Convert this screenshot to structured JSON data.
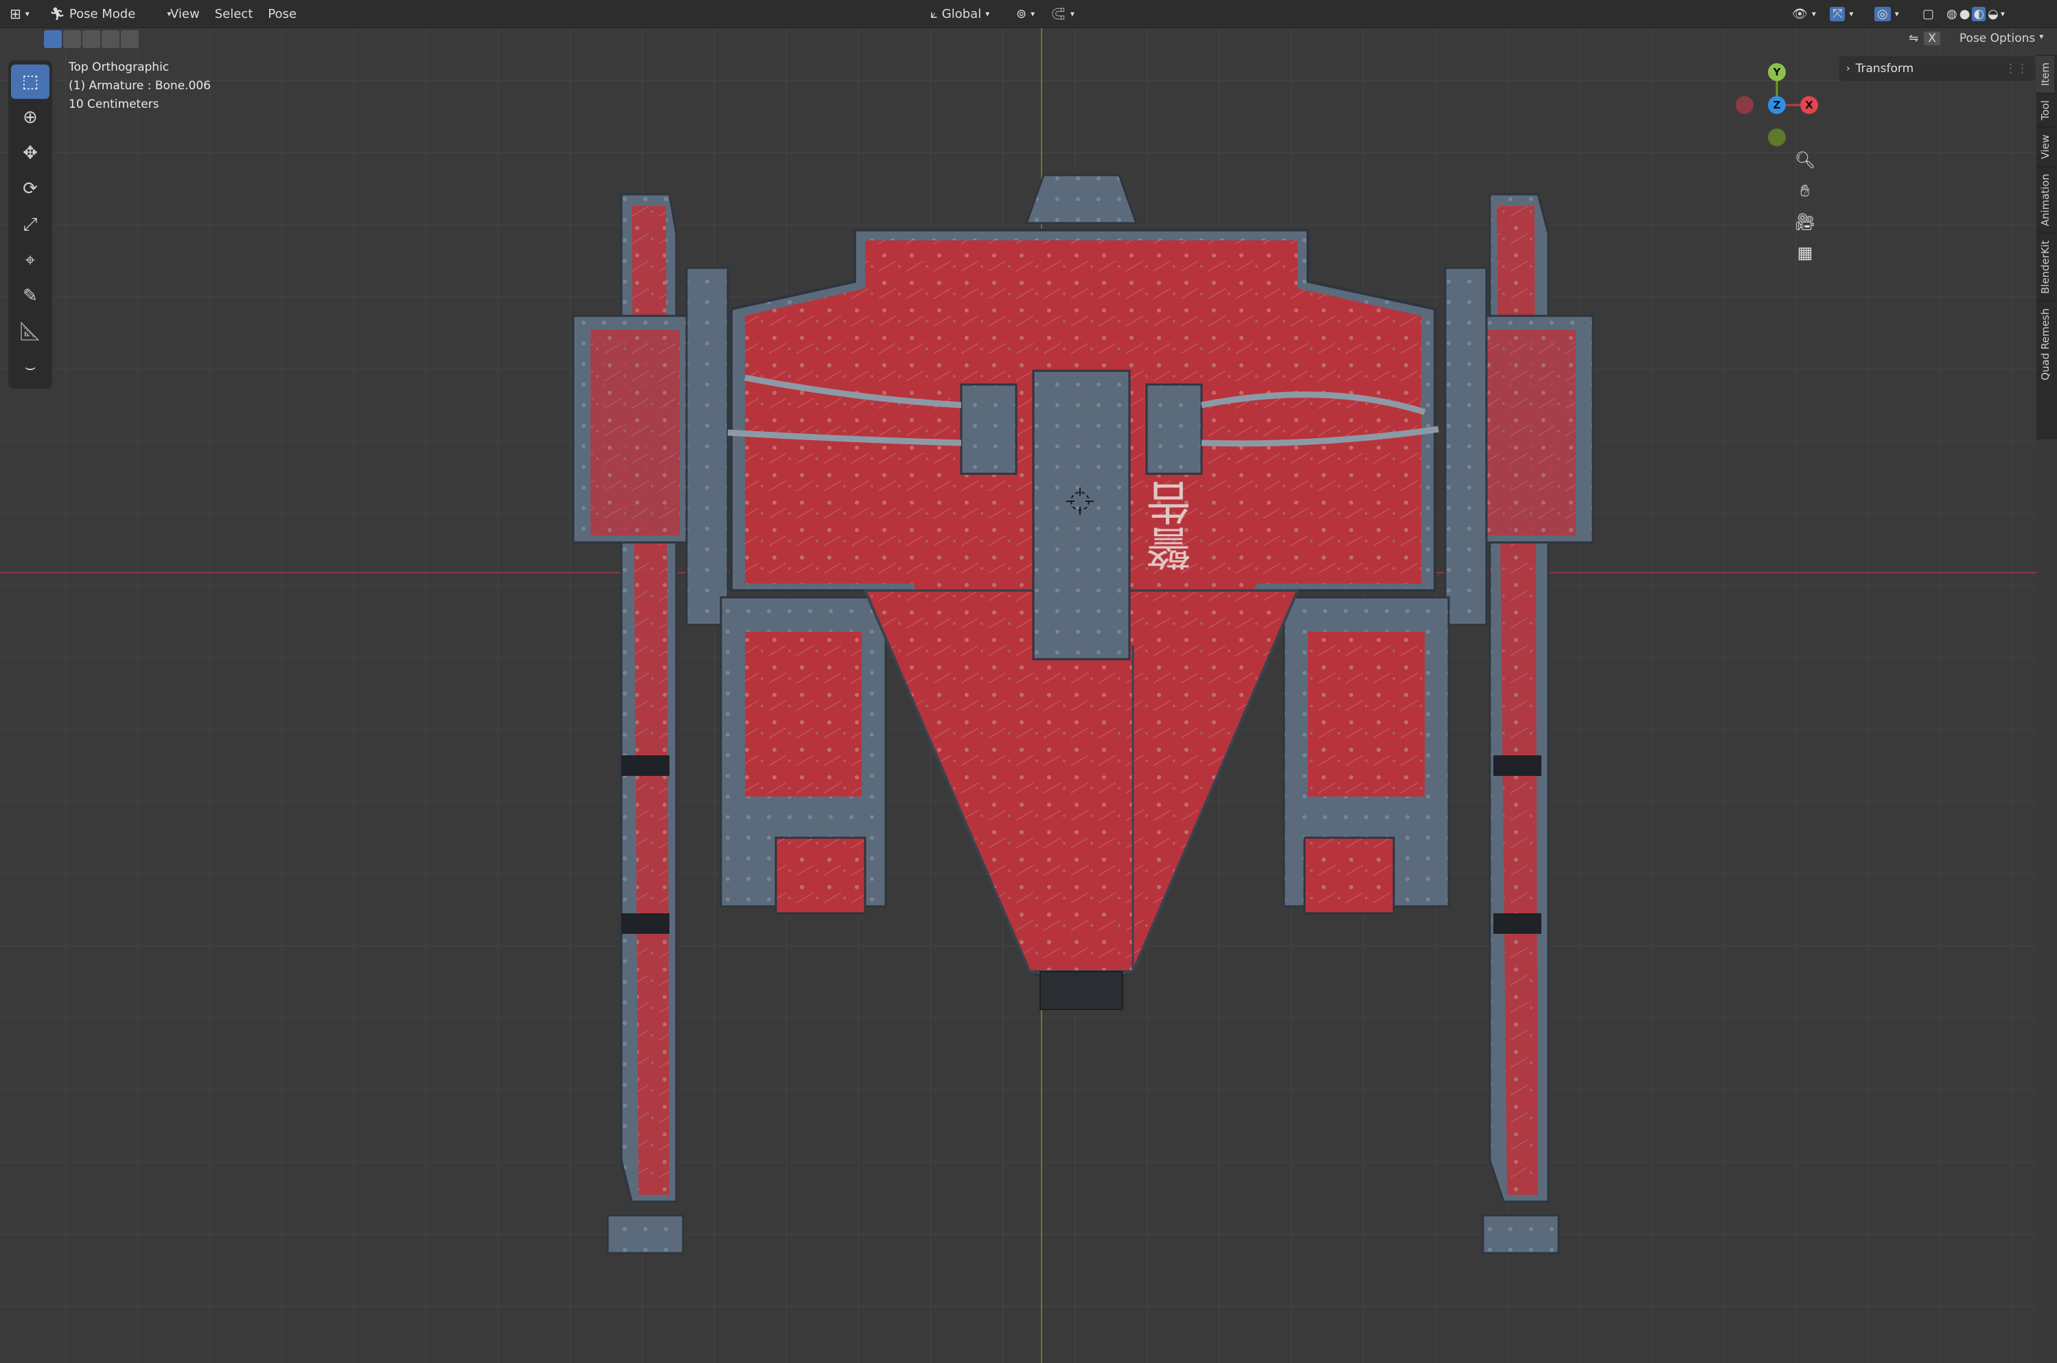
{
  "header": {
    "editor_icon": "editor-type-icon",
    "mode_label": "Pose Mode",
    "menus": [
      "View",
      "Select",
      "Pose"
    ],
    "orientation_label": "Global",
    "pose_options_label": "Pose Options",
    "x_toggle": "X"
  },
  "viewport": {
    "view_name": "Top Orthographic",
    "object_info": "(1) Armature : Bone.006",
    "scale_info": "10 Centimeters",
    "decal_text": "警告",
    "colors": {
      "body_red": "#b8343d",
      "metal": "#5c6b7c",
      "grid_x": "#8a3a45",
      "grid_y": "#6a7a2a"
    }
  },
  "gizmo": {
    "y": "Y",
    "z": "Z",
    "x": "X"
  },
  "npanel": {
    "transform_label": "Transform"
  },
  "sidetabs": [
    "Item",
    "Tool",
    "View",
    "Animation",
    "BlenderKit",
    "Quad Remesh"
  ],
  "tools": [
    "select-box-icon",
    "cursor-icon",
    "move-icon",
    "rotate-icon",
    "scale-icon",
    "transform-icon",
    "annotate-icon",
    "measure-icon",
    "relax-pose-icon"
  ]
}
